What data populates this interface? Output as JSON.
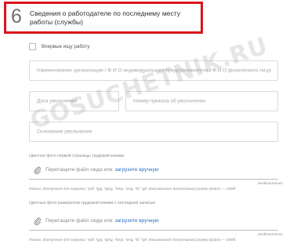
{
  "section": {
    "number": "6",
    "title": "Сведения о работодателе по последнему месту работы (службы)"
  },
  "checkbox": {
    "label": "Впервые ищу работу"
  },
  "fields": {
    "organization": "Наименование организации / Ф И О индивидуального предпринимателя / Ф И О физического лица",
    "dismissal_date": "Дата увольнения",
    "order_number": "Номер приказа об увольнении",
    "dismissal_reason": "Основание увольнения"
  },
  "upload1": {
    "caption": "Цветное фото первой страницы трудовой книжки",
    "text": "Перетащите файл сюда или",
    "link": "загрузите вручную",
    "optional": "необязательно",
    "note": "Файлы, доступные для загрузки: *pdf, *jpg, *jpeg, *bmp, *png, *tif, *gif. Максимально допустимый размер файла — 10Мб"
  },
  "upload2": {
    "caption": "Цветные фото разворотов трудовой книжки с последней записью",
    "text": "Перетащите файл сюда или",
    "link": "загрузите вручную",
    "optional": "необязательно",
    "note": "Файлы, доступные для загрузки: *pdf, *jpg, *jpeg, *bmp, *png, *tif, *gif. Максимально допустимый размер файла — 20Мб"
  },
  "watermark": "GOSUCHETNIK.RU",
  "colors": {
    "highlight": "#d9151d",
    "link": "#2c6ec1"
  }
}
